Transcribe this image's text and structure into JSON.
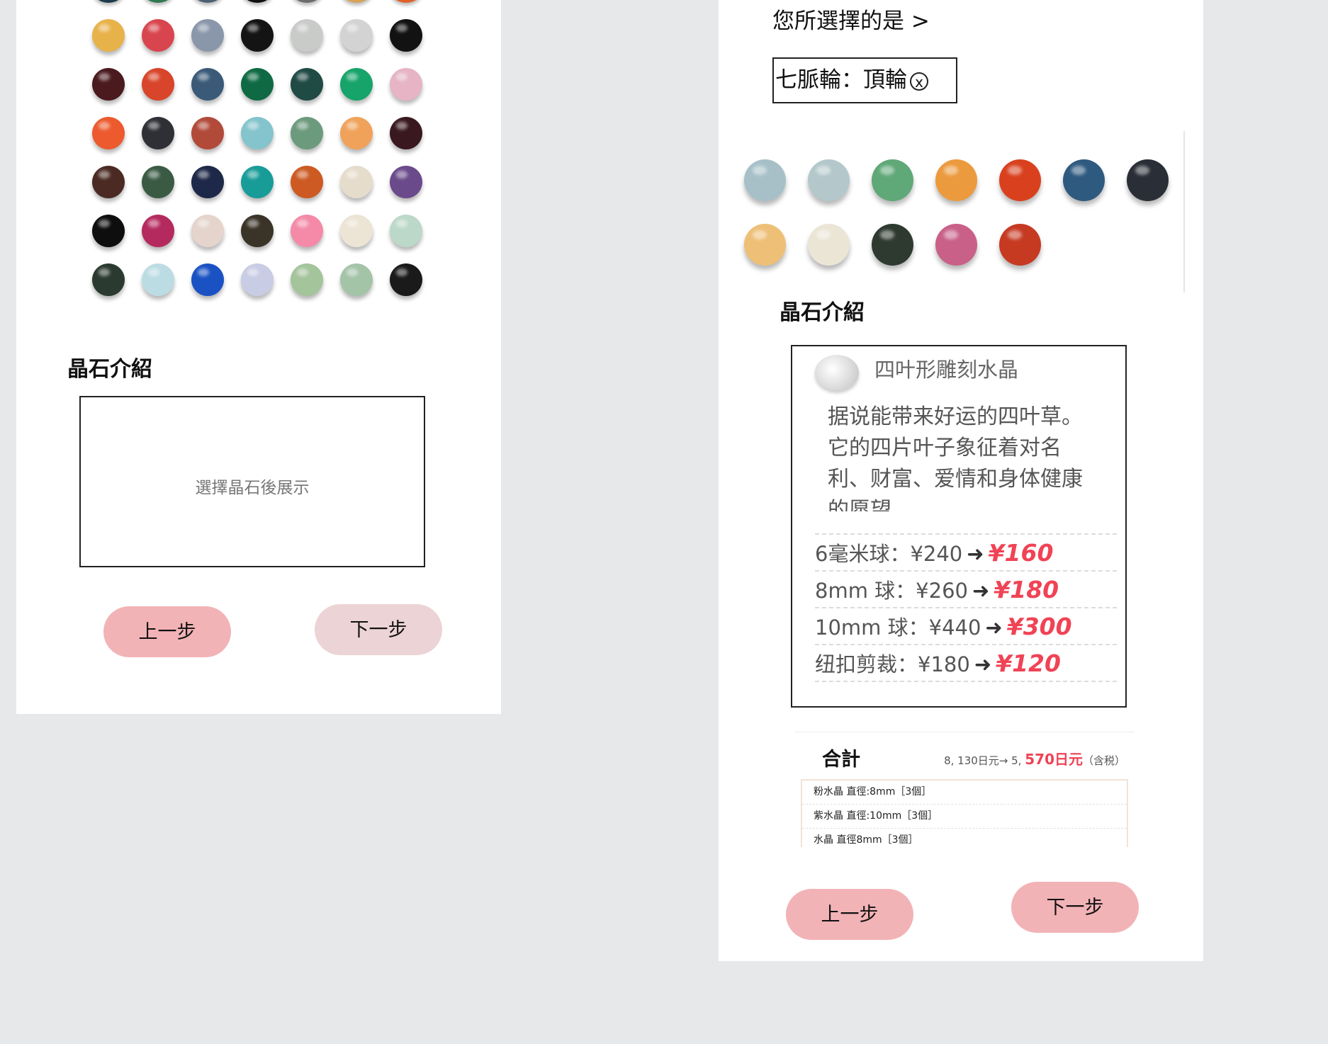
{
  "left_screen": {
    "section_title": "晶石介紹",
    "intro_placeholder": "選擇晶石後展示",
    "prev_label": "上一步",
    "next_label": "下一步",
    "partial_top_row_colors": [
      "#1e3b4a",
      "#2f7a4e",
      "#4c6072",
      "#111111",
      "#6c6c6c",
      "#d5a35a",
      "#e0622a"
    ],
    "bead_colors": [
      [
        "#e8b24a",
        "#d8454e",
        "#8a97aa",
        "#141414",
        "#c9cbc9",
        "#d3d3d3",
        "#121212"
      ],
      [
        "#4a1a1e",
        "#d8452a",
        "#3a5a78",
        "#0f6a43",
        "#204a44",
        "#16a46a",
        "#e6b4c4"
      ],
      [
        "#ec5a2e",
        "#2e3036",
        "#b24a3a",
        "#84c4cc",
        "#6c9a7c",
        "#f0a25a",
        "#3a1820"
      ],
      [
        "#4a2a22",
        "#3a5a44",
        "#1e2848",
        "#189c98",
        "#cc5a22",
        "#e6dccc",
        "#6a4a8a"
      ],
      [
        "#0e0e0e",
        "#b42a5e",
        "#e4d4cc",
        "#3a3428",
        "#f48aa8",
        "#ece4d4",
        "#bcd8c8"
      ],
      [
        "#2a3a30",
        "#bcdce4",
        "#1a52c4",
        "#c8cce4",
        "#a4c49c",
        "#a4c4a8",
        "#1a1a1a"
      ]
    ]
  },
  "right_screen": {
    "selected_label": "您所選擇的是 >",
    "selected_tag": "七脈輪：頂輪",
    "remove_glyph": "x",
    "bead_row_1": [
      "#a7c0c8",
      "#b4c8cc",
      "#5fa877",
      "#eb9a3e",
      "#d9411e",
      "#2f5a80",
      "#2a2e36"
    ],
    "bead_row_2": [
      "#eebf76",
      "#ebe5d6",
      "#2e3a30",
      "#c96088",
      "#c63a22"
    ],
    "section_title": "晶石介紹",
    "crystal_name": "四叶形雕刻水晶",
    "crystal_description": "据说能带来好运的四叶草。它的四片叶子象征着对名利、财富、爱情和身体健康的愿望。",
    "price_rows": [
      {
        "label": "6毫米球：¥240",
        "arrow": "➜",
        "price": "¥160"
      },
      {
        "label": "8mm 球：¥260",
        "arrow": "➜",
        "price": "¥180"
      },
      {
        "label": "10mm 球：¥440",
        "arrow": "➜",
        "price": "¥300"
      },
      {
        "label": "纽扣剪裁：¥180",
        "arrow": "➜",
        "price": "¥120"
      }
    ],
    "total_title": "合計",
    "total_old": "8, 130日元→ 5, ",
    "total_new": "570日元",
    "total_tax": "（含税）",
    "order_items": [
      "粉水晶  直徑:8mm［3個］",
      "紫水晶  直徑:10mm［3個］",
      "水晶  直徑8mm［3個］"
    ],
    "prev_label": "上一步",
    "next_label": "下一步"
  }
}
